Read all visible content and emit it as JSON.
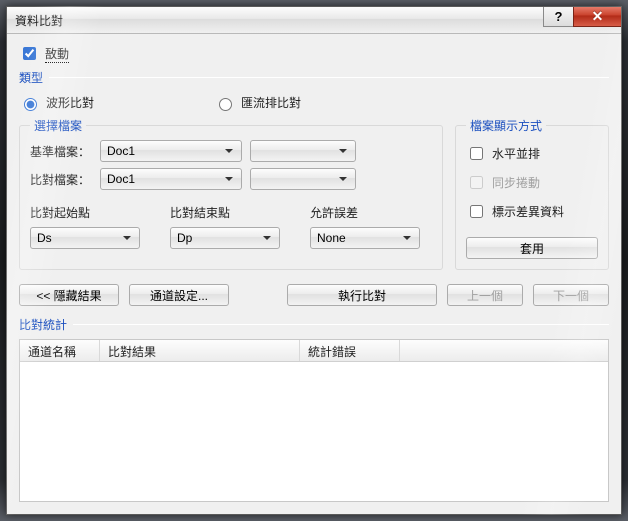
{
  "window": {
    "title": "資料比對"
  },
  "enable": {
    "label": "敔動",
    "checked": true
  },
  "type": {
    "legend": "類型",
    "waveform": {
      "label": "波形比對",
      "selected": true
    },
    "bus": {
      "label": "匯流排比對",
      "selected": false
    }
  },
  "files": {
    "legend": "選擇檔案",
    "base_label": "基準檔案：",
    "base_value": "Doc1",
    "base_aux": "",
    "compare_label": "比對檔案：",
    "compare_value": "Doc1",
    "compare_aux": ""
  },
  "display": {
    "legend": "檔案顯示方式",
    "horiz": {
      "label": "水平並排",
      "checked": false
    },
    "sync": {
      "label": "同步捲動",
      "checked": false,
      "disabled": true
    },
    "mark": {
      "label": "標示差異資料",
      "checked": false
    },
    "apply": "套用"
  },
  "range": {
    "start_label": "比對起始點",
    "start_value": "Ds",
    "end_label": "比對結束點",
    "end_value": "Dp",
    "tol_label": "允許誤差",
    "tol_value": "None"
  },
  "actions": {
    "hide": "<<  隱藏結果",
    "channel": "通道設定...",
    "run": "執行比對",
    "prev": "上一個",
    "next": "下一個"
  },
  "stats": {
    "legend": "比對統計",
    "cols": {
      "c1": "通道名稱",
      "c2": "比對結果",
      "c3": "統計錯誤"
    }
  }
}
